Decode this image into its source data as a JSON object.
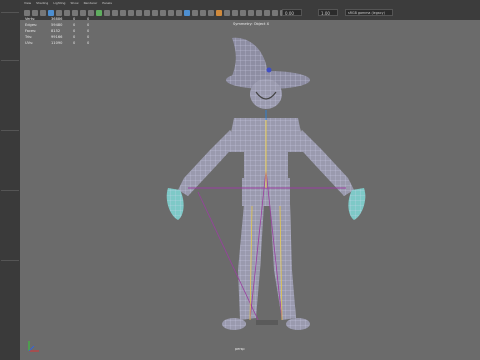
{
  "menu": [
    "View",
    "Shading",
    "Lighting",
    "Show",
    "Renderer",
    "Panels"
  ],
  "toolbar": {
    "value_field": "0.00",
    "value_field2": "1.00",
    "colorspace": "sRGB gamma (legacy)"
  },
  "hud": {
    "rows": [
      {
        "label": "Verts:",
        "v1": "36886",
        "v2": "0",
        "v3": "0"
      },
      {
        "label": "Edges:",
        "v1": "59480",
        "v2": "0",
        "v3": "0"
      },
      {
        "label": "Faces:",
        "v1": "8152",
        "v2": "0",
        "v3": "0"
      },
      {
        "label": "Tris:",
        "v1": "99166",
        "v2": "0",
        "v3": "0"
      },
      {
        "label": "UVs:",
        "v1": "11090",
        "v2": "0",
        "v3": "0"
      }
    ]
  },
  "viewport": {
    "title": "Symmetry: Object X",
    "camera": "persp"
  },
  "colors": {
    "viewport_bg": "#6b6b6b",
    "mesh_fill": "#9a9aae",
    "wire": "#d9d9f2",
    "joint": "#e6c84a",
    "bone": "#9a3fa0",
    "accent": "#4d8fd1"
  },
  "icons": [
    "select-icon",
    "lasso-icon",
    "paint-icon",
    "move-icon",
    "rotate-icon",
    "scale-icon",
    "snap-grid-icon",
    "snap-curve-icon",
    "snap-point-icon",
    "render-icon",
    "camera-icon",
    "light-icon"
  ]
}
